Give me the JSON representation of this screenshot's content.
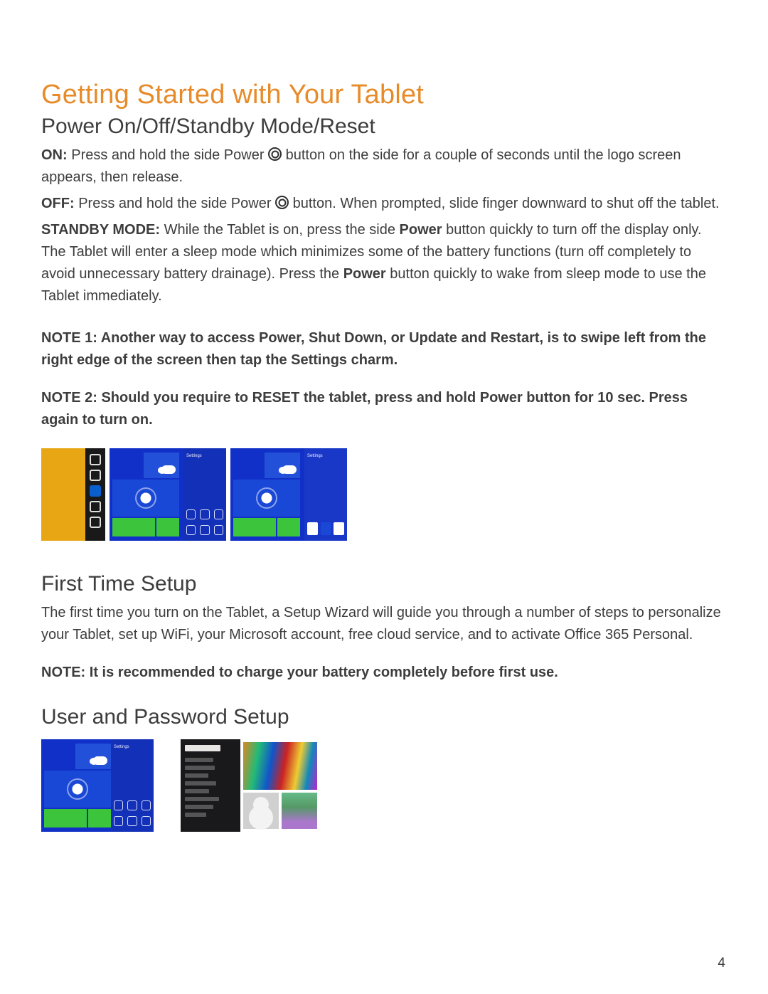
{
  "title": "Getting Started with Your Tablet",
  "s1": {
    "heading": "Power On/Off/Standby Mode/Reset",
    "on_label": "ON:",
    "on_text_a": " Press and hold the side Power ",
    "on_text_b": " button on the side for a couple of seconds until the logo screen appears, then release.",
    "off_label": "OFF:",
    "off_text_a": " Press and hold the side Power ",
    "off_text_b": " button. When prompted, slide finger downward to shut off the tablet.",
    "standby_label": "STANDBY MODE:",
    "standby_a": " While the Tablet is on, press the side ",
    "standby_power": "Power",
    "standby_b": " button quickly to turn off the display only. The Tablet will enter a sleep mode which minimizes some of the battery functions (turn off completely to avoid unnecessary battery drainage). Press the ",
    "standby_c": " button quickly to wake from sleep mode to use the Tablet immediately.",
    "note1": "NOTE 1: Another way to access Power, Shut Down, or Update and Restart, is to swipe left from the right edge of the screen then tap the Settings charm.",
    "note2": "NOTE 2: Should you require to RESET the tablet, press and hold Power button for 10 sec. Press again to turn on."
  },
  "s2": {
    "heading": "First Time Setup",
    "body": "The first time you turn on the Tablet, a Setup Wizard will guide you through a number of steps to personalize your Tablet, set up WiFi, your Microsoft account, free cloud service, and to activate Office 365 Personal.",
    "note": "NOTE: It is recommended to charge your battery completely before first use."
  },
  "s3": {
    "heading": "User and Password Setup"
  },
  "page_number": "4"
}
